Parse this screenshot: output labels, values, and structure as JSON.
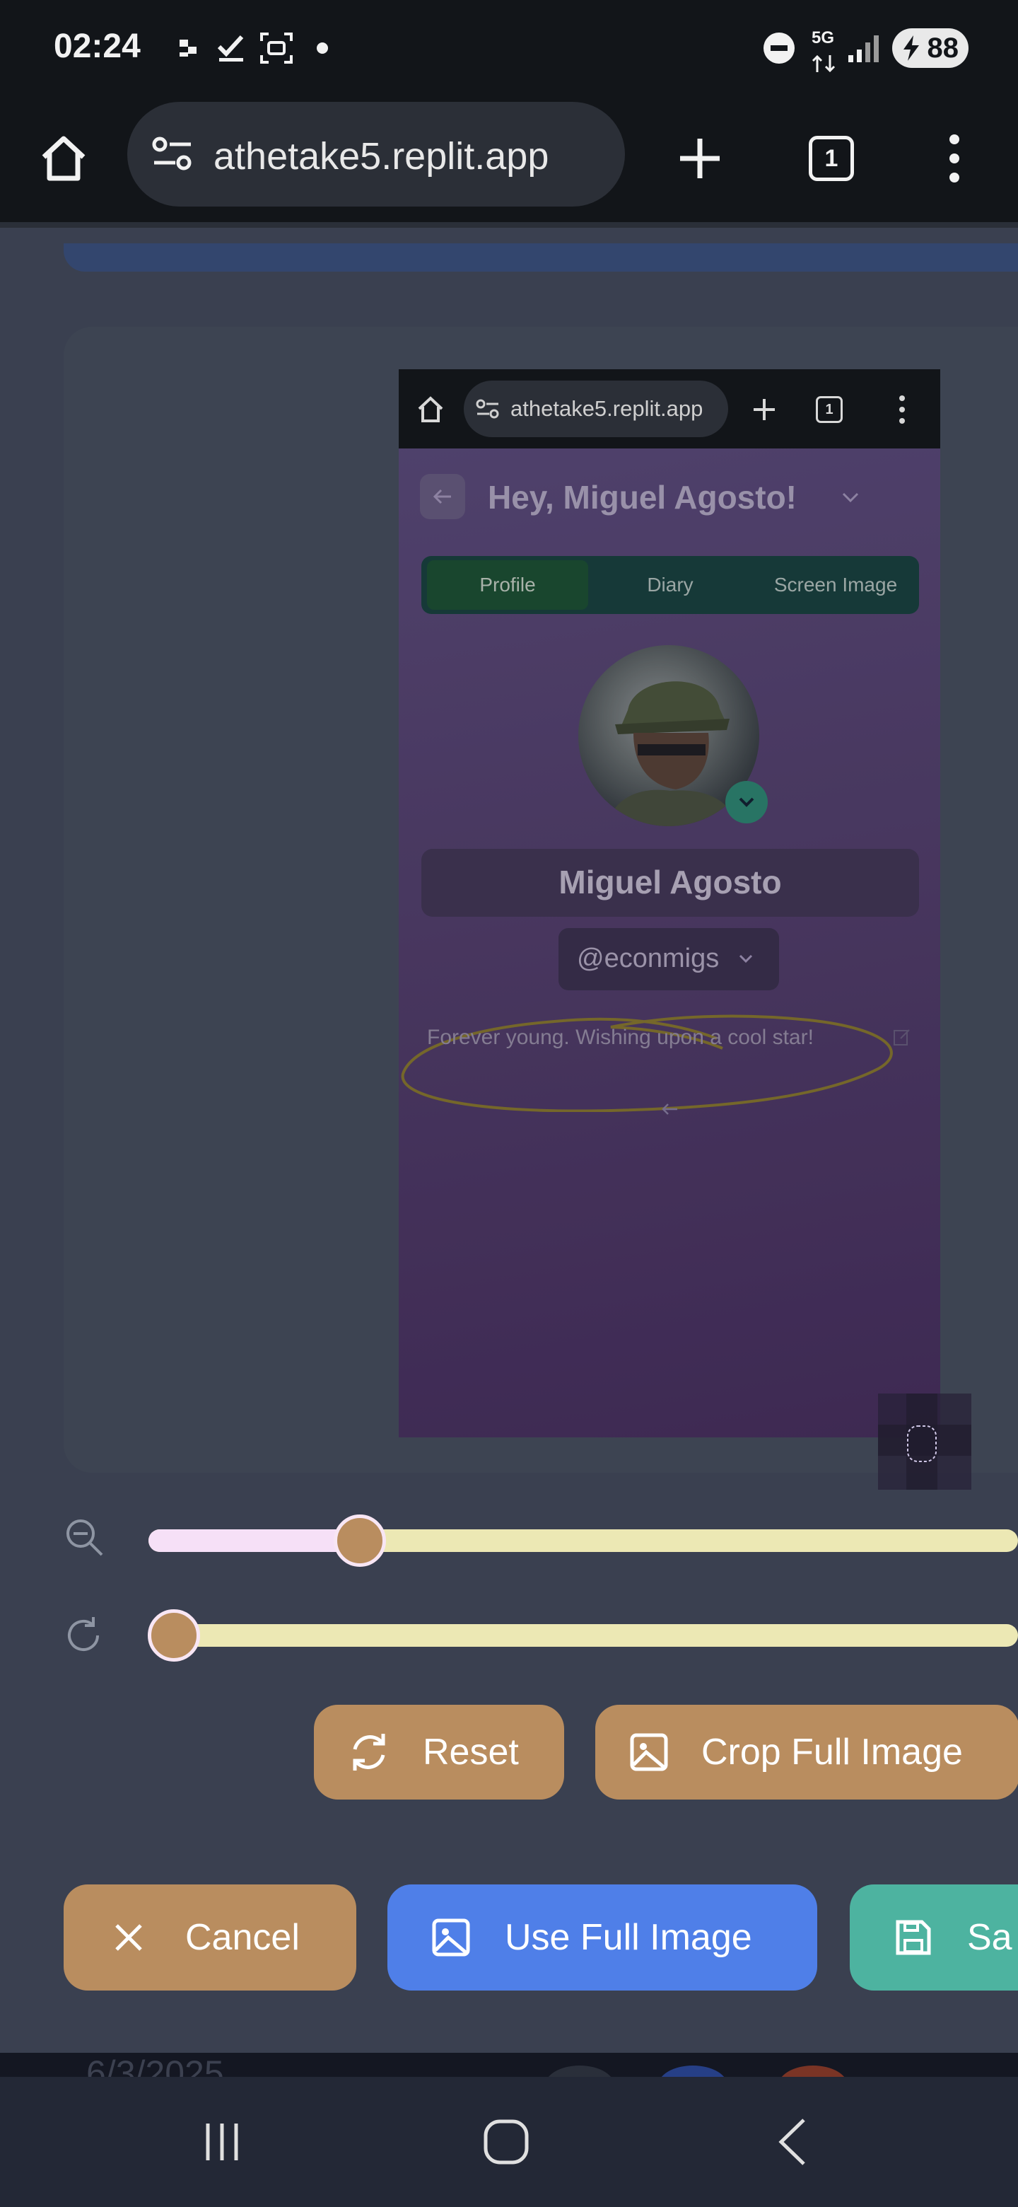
{
  "status_bar": {
    "time": "02:24",
    "network": "5G",
    "battery": "88",
    "icons": [
      "notification-dots-icon",
      "checkmark-icon",
      "screenshot-icon",
      "dot-icon",
      "do-not-disturb-icon",
      "signal-icon",
      "battery-charging-icon"
    ]
  },
  "browser": {
    "url": "athetake5.replit.app",
    "tab_count": "1",
    "icons": [
      "home-icon",
      "site-settings-icon",
      "new-tab-icon",
      "tab-switcher-icon",
      "menu-icon"
    ]
  },
  "crop_preview": {
    "url": "athetake5.replit.app",
    "tab_count": "1",
    "greeting": "Hey, Miguel Agosto!",
    "tabs": [
      "Profile",
      "Diary",
      "Screen Image"
    ],
    "active_tab": "Profile",
    "name": "Miguel Agosto",
    "handle": "@econmigs",
    "bio": "Forever young. Wishing upon a cool star!"
  },
  "controls": {
    "zoom_level": 0.22,
    "rotation_level": 0.0,
    "reset_label": "Reset",
    "crop_full_label": "Crop Full Image",
    "cancel_label": "Cancel",
    "use_full_label": "Use Full Image",
    "save_label": "Sa"
  },
  "background_page": {
    "date": "6/3/2025"
  },
  "colors": {
    "accent_tan": "#b98d5f",
    "accent_blue": "#4f7fe8",
    "accent_teal": "#4db3a0",
    "slider_track": "#ece8b4",
    "slider_fill": "#f6e0f7"
  }
}
